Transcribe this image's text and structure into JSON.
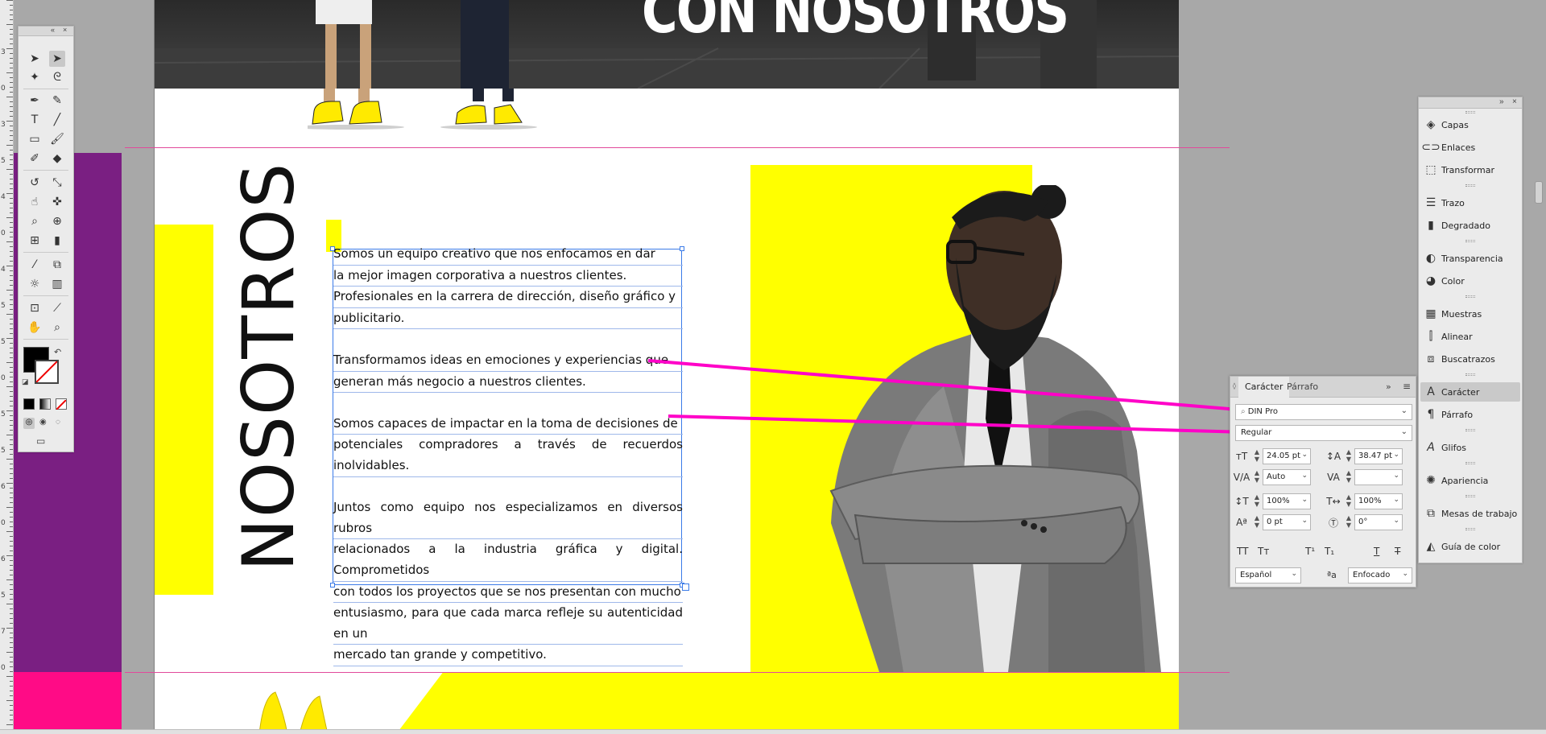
{
  "ruler": {
    "labels": [
      "3",
      "0",
      "3",
      "5",
      "4",
      "0",
      "4",
      "5",
      "5",
      "0",
      "5",
      "5",
      "6",
      "0",
      "6",
      "5",
      "7",
      "0"
    ]
  },
  "page": {
    "hero_title": "CON NOSOTROS",
    "vertical_title": "NOSOTROS",
    "paragraphs": [
      [
        "Somos un equipo creativo que nos enfocamos en dar",
        "la mejor imagen corporativa a nuestros clientes.",
        "Profesionales en la carrera de dirección, diseño gráfico y",
        "publicitario."
      ],
      [
        "Transformamos ideas en emociones y experiencias que",
        "generan más negocio a nuestros clientes."
      ],
      [
        "Somos capaces de impactar en la toma de decisiones de",
        "potenciales compradores a través de recuerdos inolvidables."
      ],
      [
        "Juntos como equipo nos especializamos en diversos rubros",
        "relacionados a la industria gráfica y digital. Comprometidos",
        "con todos los proyectos que se nos presentan con mucho",
        "entusiasmo, para que cada marca refleje su autenticidad en un",
        "mercado tan grande y competitivo."
      ]
    ],
    "colors": {
      "purple": "#7a1f82",
      "pink": "#ff0b86",
      "yellow": "#ffff00",
      "link": "#ff00c8"
    }
  },
  "tools_panel": {
    "tools": [
      "selection-tool",
      "direct-selection-tool",
      "magic-wand-tool",
      "lasso-tool",
      "pen-tool",
      "curvature-tool",
      "type-tool",
      "line-tool",
      "rectangle-tool",
      "paintbrush-tool",
      "shaper-tool",
      "eraser-tool",
      "rotate-tool",
      "scale-tool",
      "warp-tool",
      "puppet-warp-tool",
      "free-transform-tool",
      "shape-builder-tool",
      "mesh-tool",
      "gradient-tool",
      "eyedropper-tool",
      "blend-tool",
      "symbol-sprayer-tool",
      "column-graph-tool",
      "artboard-tool",
      "slice-tool",
      "hand-tool",
      "zoom-tool"
    ]
  },
  "right_panel": {
    "items": [
      {
        "label": "Capas",
        "icon": "layers-icon"
      },
      {
        "label": "Enlaces",
        "icon": "links-icon"
      },
      {
        "label": "Transformar",
        "icon": "transform-icon"
      },
      {
        "label": "Trazo",
        "icon": "stroke-icon"
      },
      {
        "label": "Degradado",
        "icon": "gradient-icon"
      },
      {
        "label": "Transparencia",
        "icon": "transparency-icon"
      },
      {
        "label": "Color",
        "icon": "color-icon"
      },
      {
        "label": "Muestras",
        "icon": "swatches-icon"
      },
      {
        "label": "Alinear",
        "icon": "align-icon"
      },
      {
        "label": "Buscatrazos",
        "icon": "pathfinder-icon"
      },
      {
        "label": "Carácter",
        "icon": "character-icon"
      },
      {
        "label": "Párrafo",
        "icon": "paragraph-icon"
      },
      {
        "label": "Glifos",
        "icon": "glyphs-icon"
      },
      {
        "label": "Apariencia",
        "icon": "appearance-icon"
      },
      {
        "label": "Mesas de trabajo",
        "icon": "artboards-icon"
      },
      {
        "label": "Guía de color",
        "icon": "color-guide-icon"
      }
    ],
    "active": "Carácter"
  },
  "character_panel": {
    "tabs": [
      "Carácter",
      "Párrafo"
    ],
    "font_family": "DIN Pro",
    "font_style": "Regular",
    "font_size": "24.05 pt",
    "leading": "38.47 pt",
    "kerning": "Auto",
    "tracking": "",
    "vertical_scale": "100%",
    "horizontal_scale": "100%",
    "baseline_shift": "0 pt",
    "rotation": "0°",
    "language": "Español",
    "antialiasing": "Enfocado",
    "aa_label": "ªa"
  }
}
